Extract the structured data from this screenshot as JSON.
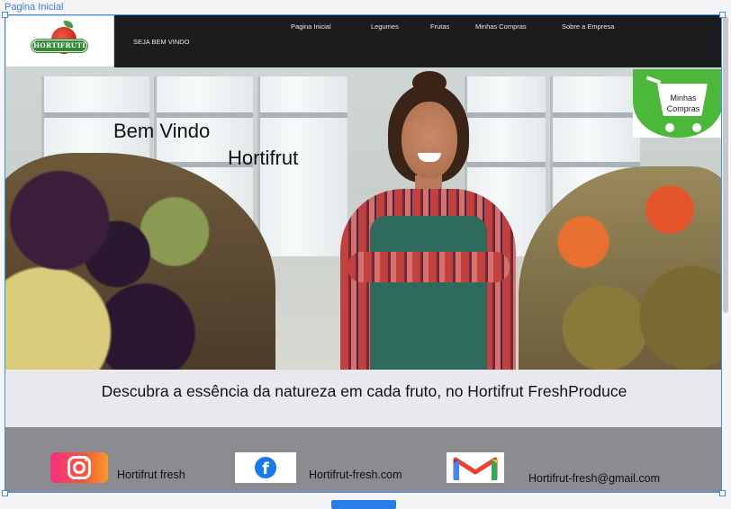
{
  "frame_label": "Pagina Inicial",
  "header": {
    "logo_text": "HORTIFRUTI",
    "welcome": "SEJA BEM VINDO",
    "nav": [
      "Pagina  Inicial",
      "Legumes",
      "Frutas",
      "Minhas Compras",
      "Sobre a  Empresa"
    ]
  },
  "hero": {
    "title_line1": "Bem Vindo",
    "title_line2": "Hortifrut",
    "cart_badge_label": "Minhas Compras"
  },
  "tagline": "Descubra a essência da natureza em cada fruto, no Hortifrut FreshProduce",
  "footer": {
    "instagram_label": "Hortifrut fresh",
    "facebook_label": "Hortifrut-fresh.com",
    "email_label": "Hortifrut-fresh@gmail.com"
  },
  "colors": {
    "header_bg": "#1c1c1e",
    "footer_bg": "#8b8b90",
    "tagline_bg": "#e9e9ed",
    "accent_green": "#4cb83a",
    "selection_blue": "#3b8ff0"
  }
}
